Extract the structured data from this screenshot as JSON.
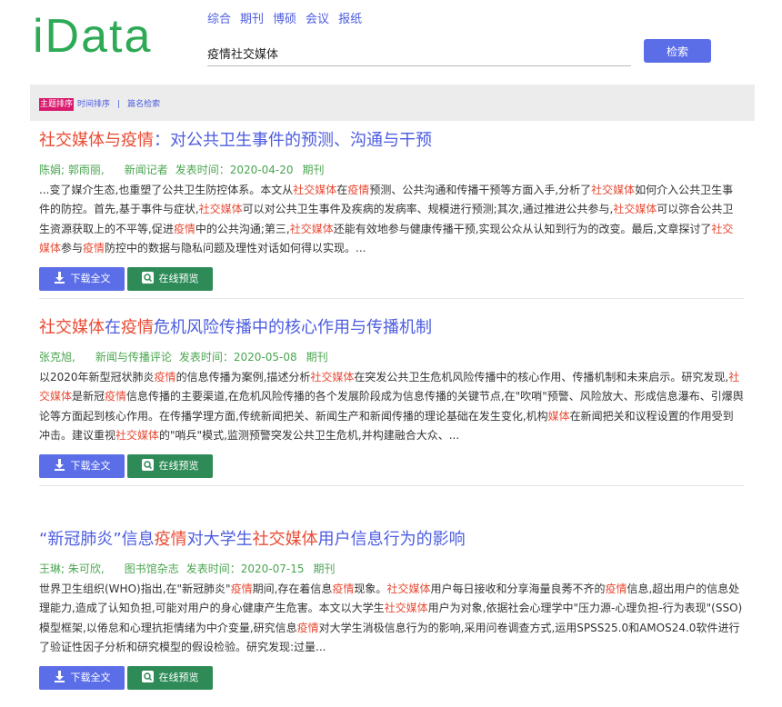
{
  "logo": "iData",
  "nav": [
    "综合",
    "期刊",
    "博硕",
    "会议",
    "报纸"
  ],
  "search": {
    "value": "疫情社交媒体",
    "button": "检索"
  },
  "sort": {
    "active": "主题排序",
    "time": "时间排序",
    "sep": "|",
    "title": "篇名检索"
  },
  "actions": {
    "download": "下载全文",
    "preview": "在线预览"
  },
  "results": [
    {
      "title": [
        [
          "社交媒体与疫情",
          true
        ],
        [
          "：对公共卫生事件的预测、沟通与干预",
          false
        ]
      ],
      "authors": "陈娟; 郭雨丽,",
      "source": "新闻记者",
      "date_label": "发表时间：",
      "date": "2020-04-20",
      "type": "期刊",
      "abstract": [
        [
          "...变了媒介生态,也重塑了公共卫生防控体系。本文从",
          false
        ],
        [
          "社交媒体",
          true
        ],
        [
          "在",
          false
        ],
        [
          "疫情",
          true
        ],
        [
          "预测、公共沟通和传播干预等方面入手,分析了",
          false
        ],
        [
          "社交媒体",
          true
        ],
        [
          "如何介入公共卫生事件的防控。首先,基于事件与症状,",
          false
        ],
        [
          "社交媒体",
          true
        ],
        [
          "可以对公共卫生事件及疾病的发病率、规模进行预测;其次,通过推进公共参与,",
          false
        ],
        [
          "社交媒体",
          true
        ],
        [
          "可以弥合公共卫生资源获取上的不平等,促进",
          false
        ],
        [
          "疫情",
          true
        ],
        [
          "中的公共沟通;第三,",
          false
        ],
        [
          "社交媒体",
          true
        ],
        [
          "还能有效地参与健康传播干预,实现公众从认知到行为的改变。最后,文章探讨了",
          false
        ],
        [
          "社交媒体",
          true
        ],
        [
          "参与",
          false
        ],
        [
          "疫情",
          true
        ],
        [
          "防控中的数据与隐私问题及理性对话如何得以实现。...",
          false
        ]
      ]
    },
    {
      "title": [
        [
          "社交媒体",
          true
        ],
        [
          "在",
          false
        ],
        [
          "疫情",
          true
        ],
        [
          "危机风险传播中的核心作用与传播机制",
          false
        ]
      ],
      "authors": "张克旭,",
      "source": "新闻与传播评论",
      "date_label": "发表时间：",
      "date": "2020-05-08",
      "type": "期刊",
      "abstract": [
        [
          "以2020年新型冠状肺炎",
          false
        ],
        [
          "疫情",
          true
        ],
        [
          "的信息传播为案例,描述分析",
          false
        ],
        [
          "社交媒体",
          true
        ],
        [
          "在突发公共卫生危机风险传播中的核心作用、传播机制和未来启示。研究发现,",
          false
        ],
        [
          "社交媒体",
          true
        ],
        [
          "是新冠",
          false
        ],
        [
          "疫情",
          true
        ],
        [
          "信息传播的主要渠道,在危机风险传播的各个发展阶段成为信息传播的关键节点,在\"吹哨\"预警、风险放大、形成信息瀑布、引爆舆论等方面起到核心作用。在传播学理方面,传统新闻把关、新闻生产和新闻传播的理论基础在发生变化,机构",
          false
        ],
        [
          "媒体",
          true
        ],
        [
          "在新闻把关和议程设置的作用受到冲击。建议重视",
          false
        ],
        [
          "社交媒体",
          true
        ],
        [
          "的\"哨兵\"模式,监测预警突发公共卫生危机,并构建融合大众、...",
          false
        ]
      ]
    },
    {
      "title": [
        [
          "“新冠肺炎”信息",
          false
        ],
        [
          "疫情",
          true
        ],
        [
          "对大学生",
          false
        ],
        [
          "社交媒体",
          true
        ],
        [
          "用户信息行为的影响",
          false
        ]
      ],
      "authors": "王琳; 朱可欣,",
      "source": "图书馆杂志",
      "date_label": "发表时间：",
      "date": "2020-07-15",
      "type": "期刊",
      "abstract": [
        [
          "世界卫生组织(WHO)指出,在\"新冠肺炎\"",
          false
        ],
        [
          "疫情",
          true
        ],
        [
          "期间,存在着信息",
          false
        ],
        [
          "疫情",
          true
        ],
        [
          "现象。",
          false
        ],
        [
          "社交媒体",
          true
        ],
        [
          "用户每日接收和分享海量良莠不齐的",
          false
        ],
        [
          "疫情",
          true
        ],
        [
          "信息,超出用户的信息处理能力,造成了认知负担,可能对用户的身心健康产生危害。本文以大学生",
          false
        ],
        [
          "社交媒体",
          true
        ],
        [
          "用户为对象,依据社会心理学中\"压力源-心理负担-行为表现\"(SSO)模型框架,以倦怠和心理抗拒情绪为中介变量,研究信息",
          false
        ],
        [
          "疫情",
          true
        ],
        [
          "对大学生消极信息行为的影响,采用问卷调查方式,运用SPSS25.0和AMOS24.0软件进行了验证性因子分析和研究模型的假设检验。研究发现:过量...",
          false
        ]
      ]
    }
  ]
}
